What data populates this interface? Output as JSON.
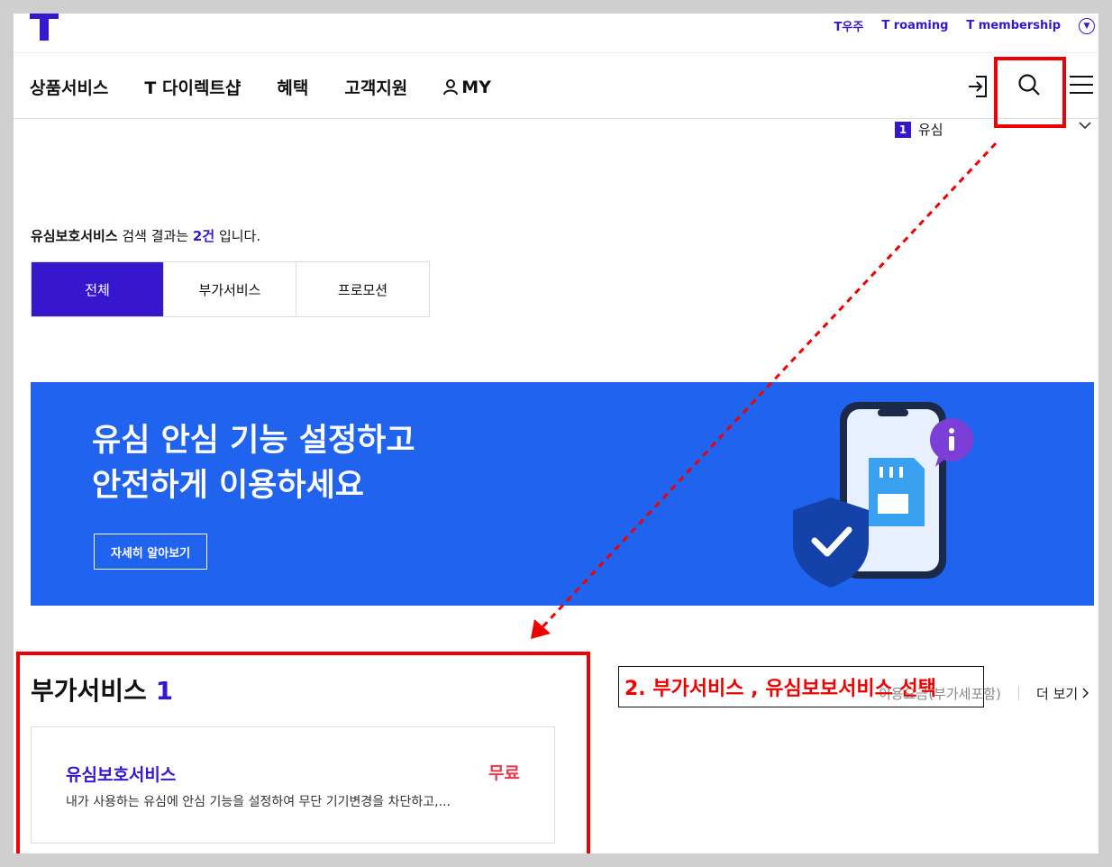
{
  "top_links": [
    "T우주",
    "T roaming",
    "T membership"
  ],
  "nav": {
    "items": [
      "상품서비스",
      "T 다이렉트샵",
      "혜택",
      "고객지원",
      "MY"
    ]
  },
  "suggestion": {
    "rank": "1",
    "text": "유심"
  },
  "summary": {
    "keyword": "유심보호서비스",
    "mid": " 검색 결과는 ",
    "count": "2건",
    "tail": " 입니다."
  },
  "tabs": [
    {
      "label": "전체",
      "active": true
    },
    {
      "label": "부가서비스",
      "active": false
    },
    {
      "label": "프로모션",
      "active": false
    }
  ],
  "banner": {
    "line1": "유심 안심 기능 설정하고",
    "line2": "안전하게 이용하세요",
    "button": "자세히 알아보기"
  },
  "section": {
    "title": "부가서비스",
    "count": "1",
    "sort": "이용요금(부가세포함)",
    "more": "더 보기"
  },
  "card": {
    "name": "유심보호서비스",
    "price": "무료",
    "desc": "내가 사용하는 유심에 안심 기능을 설정하여 무단 기기변경을 차단하고,..."
  },
  "annotation": "2. 부가서비스 , 유심보보서비스 선택",
  "colors": {
    "brand": "#3617ce",
    "banner": "#1f63ef",
    "highlight": "#ee0000",
    "price": "#e8374a"
  }
}
